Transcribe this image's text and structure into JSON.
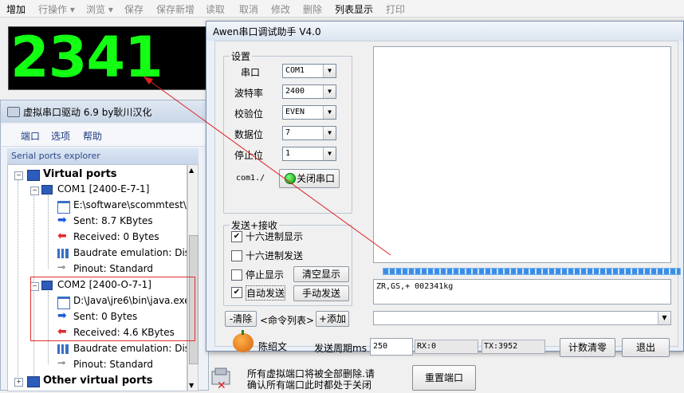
{
  "toolbar": {
    "items": [
      "增加",
      "行操作 ▾",
      "浏览 ▾",
      "保存",
      "保存新增",
      "读取",
      "取消",
      "修改",
      "删除",
      "列表显示",
      "打印"
    ]
  },
  "display": {
    "value": "2341"
  },
  "vspd": {
    "title": "虚拟串口驱动 6.9 by耿川汉化",
    "menu": [
      "端口",
      "选项",
      "帮助"
    ],
    "panel_header": "Serial ports explorer",
    "tree": {
      "virtual_ports": "Virtual ports",
      "com1": {
        "label": "COM1 [2400-E-7-1]",
        "path": "E:\\software\\scommtest\\",
        "sent": "Sent: 8.7 KBytes",
        "received": "Received: 0 Bytes",
        "baud": "Baudrate emulation: Dis",
        "pinout": "Pinout: Standard"
      },
      "com2": {
        "label": "COM2 [2400-O-7-1]",
        "path": "D:\\Java\\jre6\\bin\\java.exe",
        "sent": "Sent: 0 Bytes",
        "received": "Received: 4.6 KBytes",
        "baud": "Baudrate emulation: Dis",
        "pinout": "Pinout: Standard"
      },
      "other": "Other virtual ports"
    }
  },
  "notice": {
    "line1": "所有虚拟端口将被全部删除.请",
    "line2": "确认所有端口此时都处于关闭",
    "reset_button": "重置端口"
  },
  "awen": {
    "title": "Awen串口调试助手 V4.0",
    "settings": {
      "group_label": "设置",
      "port_label": "串口",
      "port_value": "COM1",
      "baud_label": "波特率",
      "baud_value": "2400",
      "parity_label": "校验位",
      "parity_value": "EVEN",
      "databits_label": "数据位",
      "databits_value": "7",
      "stopbits_label": "停止位",
      "stopbits_value": "1",
      "status": "com1./",
      "close_button": "关闭串口"
    },
    "sendrecv": {
      "group_label": "发送+接收",
      "hex_display": "十六进制显示",
      "hex_send": "十六进制发送",
      "stop_display": "停止显示",
      "auto_send": "自动发送",
      "clear_display": "清空显示",
      "manual_send": "手动发送"
    },
    "cmd": {
      "clear": "-清除",
      "list": "<命令列表>",
      "add": "+添加"
    },
    "author": "陈绍文",
    "period_label": "发送周期ms",
    "period_value": "250",
    "rx": "RX:0",
    "tx": "TX:3952",
    "reset_count": "计数清零",
    "exit": "退出",
    "send_text": "ZR,GS,+ 002341kg",
    "receive_text": ""
  },
  "colors": {
    "display_digits": "#13ff13",
    "arrow": "#e02020"
  }
}
